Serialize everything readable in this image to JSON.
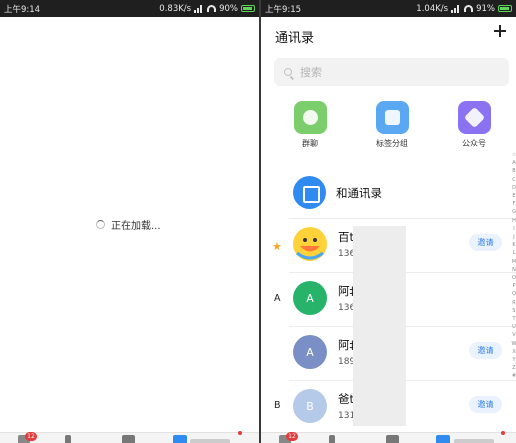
{
  "left_phone": {
    "status": {
      "time": "上午9:14",
      "speed": "0.83K/s",
      "battery": "90%"
    },
    "loading_text": "正在加载...",
    "tab_badge": "12"
  },
  "right_phone": {
    "status": {
      "time": "上午9:15",
      "speed": "1.04K/s",
      "battery": "91%"
    },
    "title": "通讯录",
    "search_placeholder": "搜索",
    "quick_actions": [
      {
        "label": "群聊",
        "icon": "group-chat-icon",
        "color": "#7ccd6c"
      },
      {
        "label": "标签分组",
        "icon": "tag-group-icon",
        "color": "#5aa7f2"
      },
      {
        "label": "公众号",
        "icon": "official-account-icon",
        "color": "#8a72f0"
      }
    ],
    "featured": {
      "label": "和通讯录",
      "icon": "contacts-book-icon"
    },
    "sections": [
      "A",
      "B"
    ],
    "contacts": [
      {
        "name": "百t",
        "phone": "136",
        "avatar_text": "",
        "avatar_color": "#ffd23a",
        "invite": "邀请"
      },
      {
        "name": "阿‡",
        "phone": "136",
        "avatar_text": "A",
        "avatar_color": "#27b36a",
        "invite": ""
      },
      {
        "name": "阿‡",
        "phone": "189",
        "avatar_text": "A",
        "avatar_color": "#7b8fc7",
        "invite": "邀请"
      },
      {
        "name": "爸t",
        "phone": "131",
        "avatar_text": "B",
        "avatar_color": "#b5c9e8",
        "invite": "邀请"
      }
    ],
    "alphabet": [
      "☆",
      "A",
      "B",
      "C",
      "D",
      "E",
      "F",
      "G",
      "H",
      "I",
      "J",
      "K",
      "L",
      "M",
      "N",
      "O",
      "P",
      "Q",
      "R",
      "S",
      "T",
      "U",
      "V",
      "W",
      "X",
      "Y",
      "Z",
      "#"
    ],
    "tab_badge": "12"
  }
}
